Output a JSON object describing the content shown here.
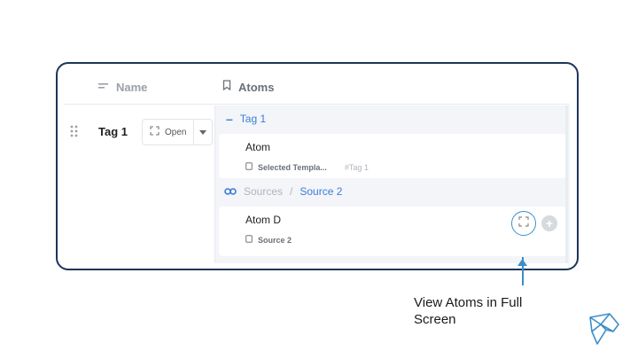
{
  "table": {
    "header": {
      "name_label": "Name",
      "atoms_label": "Atoms",
      "name_icon": "lines-icon",
      "atoms_icon": "bookmark-icon"
    },
    "row": {
      "tag_label": "Tag 1",
      "open_button_label": "Open",
      "open_icon": "expand-icon",
      "dropdown_icon": "caret-down-icon"
    },
    "group": {
      "collapse_icon": "minus-icon",
      "tag_name": "Tag 1"
    },
    "atoms": [
      {
        "title": "Atom",
        "meta_label": "Selected Templa...",
        "meta_tag": "#Tag 1"
      },
      {
        "title": "Atom D",
        "meta_label": "Source 2"
      }
    ],
    "source_row": {
      "icon": "link-icon",
      "parent": "Sources",
      "separator": "/",
      "current": "Source 2"
    }
  },
  "annotation": {
    "text": "View Atoms in Full Screen"
  },
  "colors": {
    "accent": "#3b7dd8",
    "frame_border": "#1d3557",
    "callout": "#3b8ec9"
  }
}
